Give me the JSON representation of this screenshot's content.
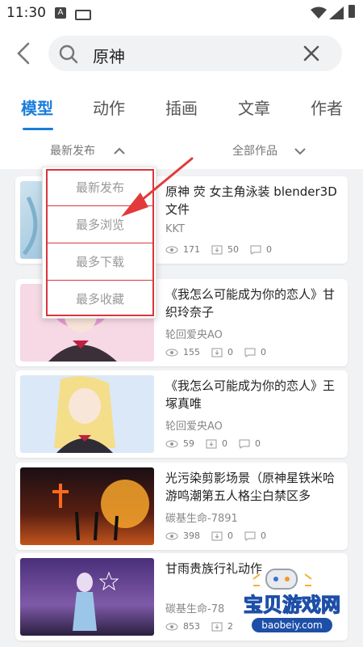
{
  "status": {
    "time": "11:30",
    "notif_letter": "A"
  },
  "search": {
    "query": "原神"
  },
  "tabs": [
    "模型",
    "动作",
    "插画",
    "文章",
    "作者"
  ],
  "filters": {
    "sort": "最新发布",
    "scope": "全部作品"
  },
  "sort_menu": [
    "最新发布",
    "最多浏览",
    "最多下载",
    "最多收藏"
  ],
  "items": [
    {
      "title": "原神 荧 女主角泳装 blender3D文件",
      "author": "KKT",
      "views": "171",
      "downloads": "50",
      "comments": "0"
    },
    {
      "title": "《我怎么可能成为你的恋人》甘织玲奈子",
      "author": "轮回爱央AO",
      "views": "155",
      "downloads": "0",
      "comments": "0"
    },
    {
      "title": "《我怎么可能成为你的恋人》王塚真唯",
      "author": "轮回爱央AO",
      "views": "59",
      "downloads": "0",
      "comments": "0"
    },
    {
      "title": "光污染剪影场景（原神星铁米哈游鸣潮第五人格尘白禁区多log...",
      "author": "碳基生命-7891",
      "views": "398",
      "downloads": "0",
      "comments": "0"
    },
    {
      "title": "甘雨贵族行礼动作",
      "author": "碳基生命-78",
      "views": "853",
      "downloads": "2",
      "comments": ""
    }
  ],
  "watermark": {
    "name": "宝贝游戏网",
    "url": "baobeiy.com"
  }
}
